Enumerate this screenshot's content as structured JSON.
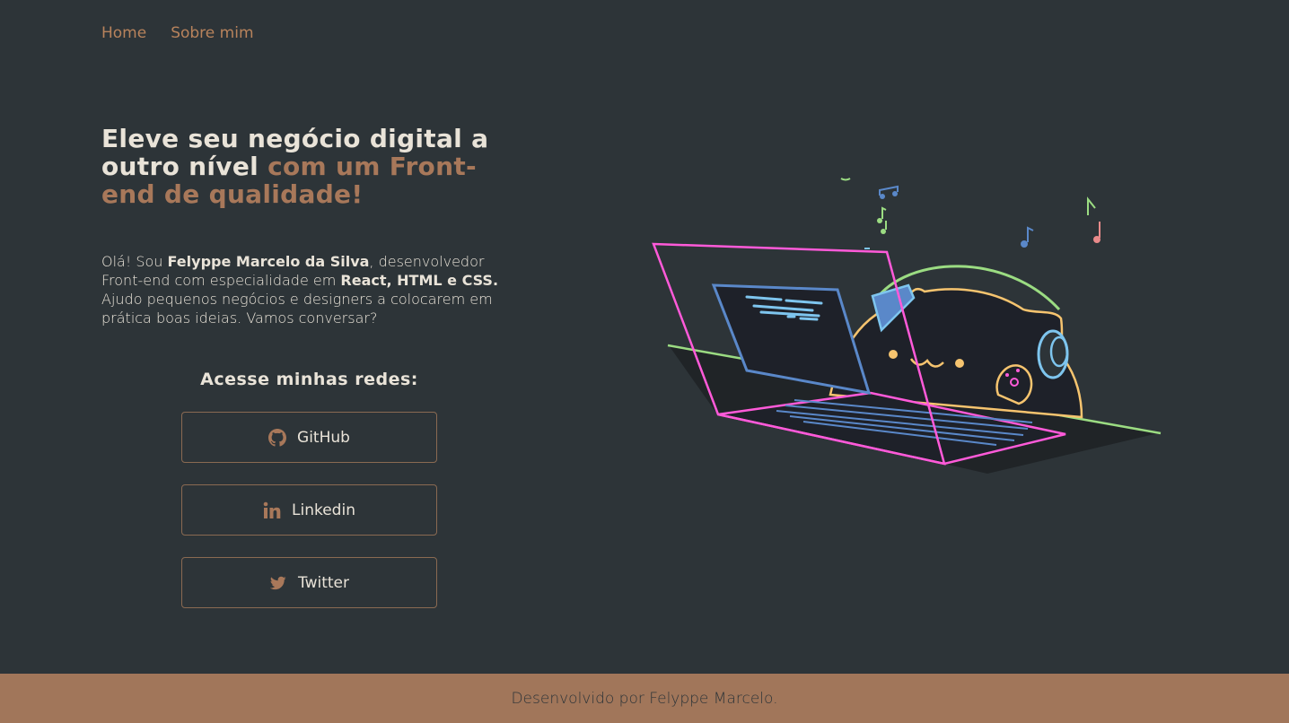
{
  "nav": {
    "home": "Home",
    "about": "Sobre mim"
  },
  "hero": {
    "title_part1": "Eleve seu negócio digital a outro nível",
    "title_part2": "com um Front-end de qualidade!"
  },
  "intro": {
    "t1": "Olá! Sou ",
    "name": "Felyppe Marcelo da Silva",
    "t2": ", desenvolvedor Front-end com especialidade em ",
    "skills": "React, HTML e CSS.",
    "t3": " Ajudo pequenos negócios e designers a colocarem em prática boas ideias. Vamos conversar?"
  },
  "social": {
    "heading": "Acesse minhas redes:",
    "buttons": [
      {
        "label": "GitHub",
        "icon": "github-icon"
      },
      {
        "label": "Linkedin",
        "icon": "linkedin-icon"
      },
      {
        "label": "Twitter",
        "icon": "twitter-icon"
      }
    ]
  },
  "illustration": {
    "description_icon": "cat-laptop-illustration"
  },
  "footer": {
    "text": "Desenvolvido por Felyppe Marcelo."
  },
  "colors": {
    "background": "#2d3438",
    "accent": "#a8785a",
    "footer_bg": "#a1765a",
    "text": "#e9e3d8"
  }
}
